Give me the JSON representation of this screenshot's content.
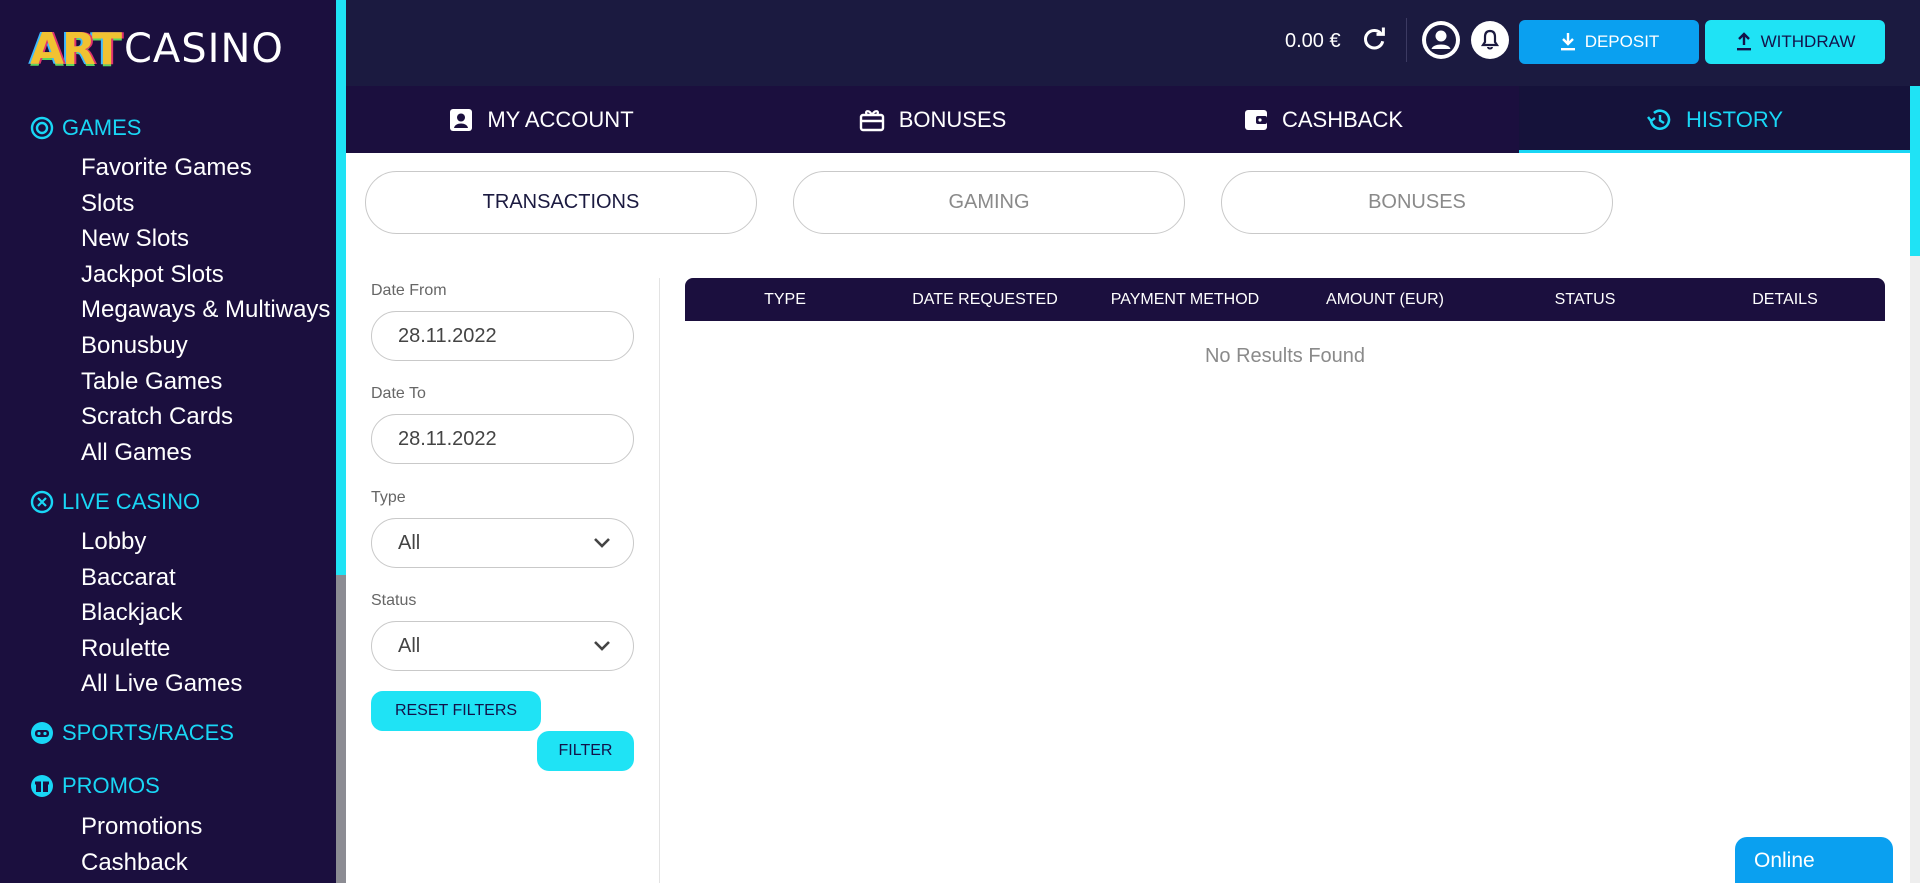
{
  "brand": {
    "art": "ART",
    "casino": "CASINO"
  },
  "sidebar": {
    "sections": [
      {
        "label": "GAMES",
        "icon": "games-icon",
        "items": [
          "Favorite Games",
          "Slots",
          "New Slots",
          "Jackpot Slots",
          "Megaways & Multiways",
          "Bonusbuy",
          "Table Games",
          "Scratch Cards",
          "All Games"
        ]
      },
      {
        "label": "LIVE CASINO",
        "icon": "live-casino-icon",
        "items": [
          "Lobby",
          "Baccarat",
          "Blackjack",
          "Roulette",
          "All Live Games"
        ]
      },
      {
        "label": "SPORTS/RACES",
        "icon": "sports-icon",
        "items": []
      },
      {
        "label": "PROMOS",
        "icon": "gift-icon",
        "items": [
          "Promotions",
          "Cashback"
        ]
      }
    ]
  },
  "header": {
    "balance": "0.00 €",
    "deposit_label": "DEPOSIT",
    "withdraw_label": "WITHDRAW"
  },
  "tabs": [
    {
      "label": "MY ACCOUNT",
      "icon": "account-card-icon",
      "active": false
    },
    {
      "label": "BONUSES",
      "icon": "gift-box-icon",
      "active": false
    },
    {
      "label": "CASHBACK",
      "icon": "wallet-icon",
      "active": false
    },
    {
      "label": "HISTORY",
      "icon": "history-icon",
      "active": true
    }
  ],
  "subtabs": [
    {
      "label": "TRANSACTIONS",
      "active": true
    },
    {
      "label": "GAMING",
      "active": false
    },
    {
      "label": "BONUSES",
      "active": false
    }
  ],
  "filters": {
    "date_from_label": "Date From",
    "date_from_value": "28.11.2022",
    "date_to_label": "Date To",
    "date_to_value": "28.11.2022",
    "type_label": "Type",
    "type_value": "All",
    "status_label": "Status",
    "status_value": "All",
    "reset_label": "RESET FILTERS",
    "filter_label": "FILTER"
  },
  "table": {
    "columns": [
      "TYPE",
      "DATE REQUESTED",
      "PAYMENT METHOD",
      "AMOUNT (EUR)",
      "STATUS",
      "DETAILS"
    ],
    "empty_text": "No Results Found"
  },
  "chat": {
    "label": "Online"
  },
  "colors": {
    "accent": "#1fe3f5",
    "deposit": "#0aa0f0",
    "navy": "#1b0f3e"
  }
}
